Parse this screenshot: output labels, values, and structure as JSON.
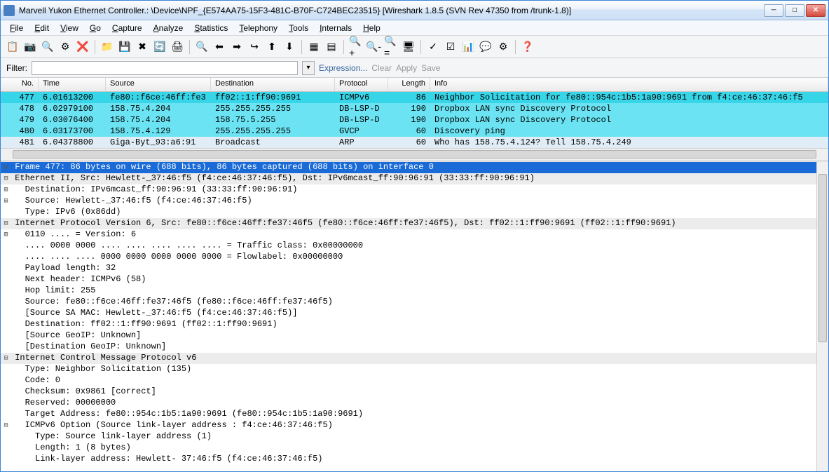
{
  "title": "Marvell Yukon Ethernet Controller.: \\Device\\NPF_{E574AA75-15F3-481C-B70F-C724BEC23515}   [Wireshark 1.8.5  (SVN Rev 47350 from /trunk-1.8)]",
  "menu": [
    "File",
    "Edit",
    "View",
    "Go",
    "Capture",
    "Analyze",
    "Statistics",
    "Telephony",
    "Tools",
    "Internals",
    "Help"
  ],
  "filter": {
    "label": "Filter:",
    "expr": "Expression...",
    "clear": "Clear",
    "apply": "Apply",
    "save": "Save",
    "value": ""
  },
  "columns": {
    "no": "No.",
    "time": "Time",
    "src": "Source",
    "dst": "Destination",
    "proto": "Protocol",
    "len": "Length",
    "info": "Info"
  },
  "packets": [
    {
      "no": "477",
      "time": "6.01613200",
      "src": "fe80::f6ce:46ff:fe3",
      "dst": "ff02::1:ff90:9691",
      "proto": "ICMPv6",
      "len": "86",
      "info": "Neighbor Solicitation for fe80::954c:1b5:1a90:9691 from f4:ce:46:37:46:f5",
      "cls": "r-sel"
    },
    {
      "no": "478",
      "time": "6.02979100",
      "src": "158.75.4.204",
      "dst": "255.255.255.255",
      "proto": "DB-LSP-D",
      "len": "190",
      "info": "Dropbox LAN sync Discovery Protocol",
      "cls": "r-db"
    },
    {
      "no": "479",
      "time": "6.03076400",
      "src": "158.75.4.204",
      "dst": "158.75.5.255",
      "proto": "DB-LSP-D",
      "len": "190",
      "info": "Dropbox LAN sync Discovery Protocol",
      "cls": "r-db"
    },
    {
      "no": "480",
      "time": "6.03173700",
      "src": "158.75.4.129",
      "dst": "255.255.255.255",
      "proto": "GVCP",
      "len": "60",
      "info": "Discovery ping",
      "cls": "r-gvcp"
    },
    {
      "no": "481",
      "time": "6.04378800",
      "src": "Giga-Byt_93:a6:91",
      "dst": "Broadcast",
      "proto": "ARP",
      "len": "60",
      "info": "Who has 158.75.4.124?  Tell 158.75.4.249",
      "cls": "r-arp"
    }
  ],
  "details": [
    {
      "ind": 0,
      "exp": "⊟",
      "txt": "Frame 477: 86 bytes on wire (688 bits), 86 bytes captured (688 bits) on interface 0",
      "cls": "frame"
    },
    {
      "ind": 0,
      "exp": "⊟",
      "txt": "Ethernet II, Src: Hewlett-_37:46:f5 (f4:ce:46:37:46:f5), Dst: IPv6mcast_ff:90:96:91 (33:33:ff:90:96:91)",
      "cls": "hdr"
    },
    {
      "ind": 1,
      "exp": "⊞",
      "txt": "Destination: IPv6mcast_ff:90:96:91 (33:33:ff:90:96:91)"
    },
    {
      "ind": 1,
      "exp": "⊞",
      "txt": "Source: Hewlett-_37:46:f5 (f4:ce:46:37:46:f5)"
    },
    {
      "ind": 1,
      "exp": " ",
      "txt": "Type: IPv6 (0x86dd)"
    },
    {
      "ind": 0,
      "exp": "⊟",
      "txt": "Internet Protocol Version 6, Src: fe80::f6ce:46ff:fe37:46f5 (fe80::f6ce:46ff:fe37:46f5), Dst: ff02::1:ff90:9691 (ff02::1:ff90:9691)",
      "cls": "hdr"
    },
    {
      "ind": 1,
      "exp": "⊞",
      "txt": "0110 .... = Version: 6"
    },
    {
      "ind": 1,
      "exp": " ",
      "txt": ".... 0000 0000 .... .... .... .... .... = Traffic class: 0x00000000"
    },
    {
      "ind": 1,
      "exp": " ",
      "txt": ".... .... .... 0000 0000 0000 0000 0000 = Flowlabel: 0x00000000"
    },
    {
      "ind": 1,
      "exp": " ",
      "txt": "Payload length: 32"
    },
    {
      "ind": 1,
      "exp": " ",
      "txt": "Next header: ICMPv6 (58)"
    },
    {
      "ind": 1,
      "exp": " ",
      "txt": "Hop limit: 255"
    },
    {
      "ind": 1,
      "exp": " ",
      "txt": "Source: fe80::f6ce:46ff:fe37:46f5 (fe80::f6ce:46ff:fe37:46f5)"
    },
    {
      "ind": 1,
      "exp": " ",
      "txt": "[Source SA MAC: Hewlett-_37:46:f5 (f4:ce:46:37:46:f5)]"
    },
    {
      "ind": 1,
      "exp": " ",
      "txt": "Destination: ff02::1:ff90:9691 (ff02::1:ff90:9691)"
    },
    {
      "ind": 1,
      "exp": " ",
      "txt": "[Source GeoIP: Unknown]"
    },
    {
      "ind": 1,
      "exp": " ",
      "txt": "[Destination GeoIP: Unknown]"
    },
    {
      "ind": 0,
      "exp": "⊟",
      "txt": "Internet Control Message Protocol v6",
      "cls": "hdr"
    },
    {
      "ind": 1,
      "exp": " ",
      "txt": "Type: Neighbor Solicitation (135)"
    },
    {
      "ind": 1,
      "exp": " ",
      "txt": "Code: 0"
    },
    {
      "ind": 1,
      "exp": " ",
      "txt": "Checksum: 0x9861 [correct]"
    },
    {
      "ind": 1,
      "exp": " ",
      "txt": "Reserved: 00000000"
    },
    {
      "ind": 1,
      "exp": " ",
      "txt": "Target Address: fe80::954c:1b5:1a90:9691 (fe80::954c:1b5:1a90:9691)"
    },
    {
      "ind": 1,
      "exp": "⊟",
      "txt": "ICMPv6 Option (Source link-layer address : f4:ce:46:37:46:f5)"
    },
    {
      "ind": 2,
      "exp": " ",
      "txt": "Type: Source link-layer address (1)"
    },
    {
      "ind": 2,
      "exp": " ",
      "txt": "Length: 1 (8 bytes)"
    },
    {
      "ind": 2,
      "exp": " ",
      "txt": "Link-layer address: Hewlett- 37:46:f5 (f4:ce:46:37:46:f5)"
    }
  ],
  "toolbar_icons": [
    "📋",
    "📷",
    "🔍",
    "⚙",
    "❌",
    "",
    "📁",
    "💾",
    "✖",
    "🔄",
    "🖨",
    "",
    "🔍",
    "⬅",
    "➡",
    "↪",
    "⬆",
    "⬇",
    "",
    "▦",
    "▤",
    "",
    "🔍+",
    "🔍-",
    "🔍=",
    "🖥",
    "",
    "✓",
    "☑",
    "📊",
    "💬",
    "⚙",
    "",
    "❓"
  ]
}
